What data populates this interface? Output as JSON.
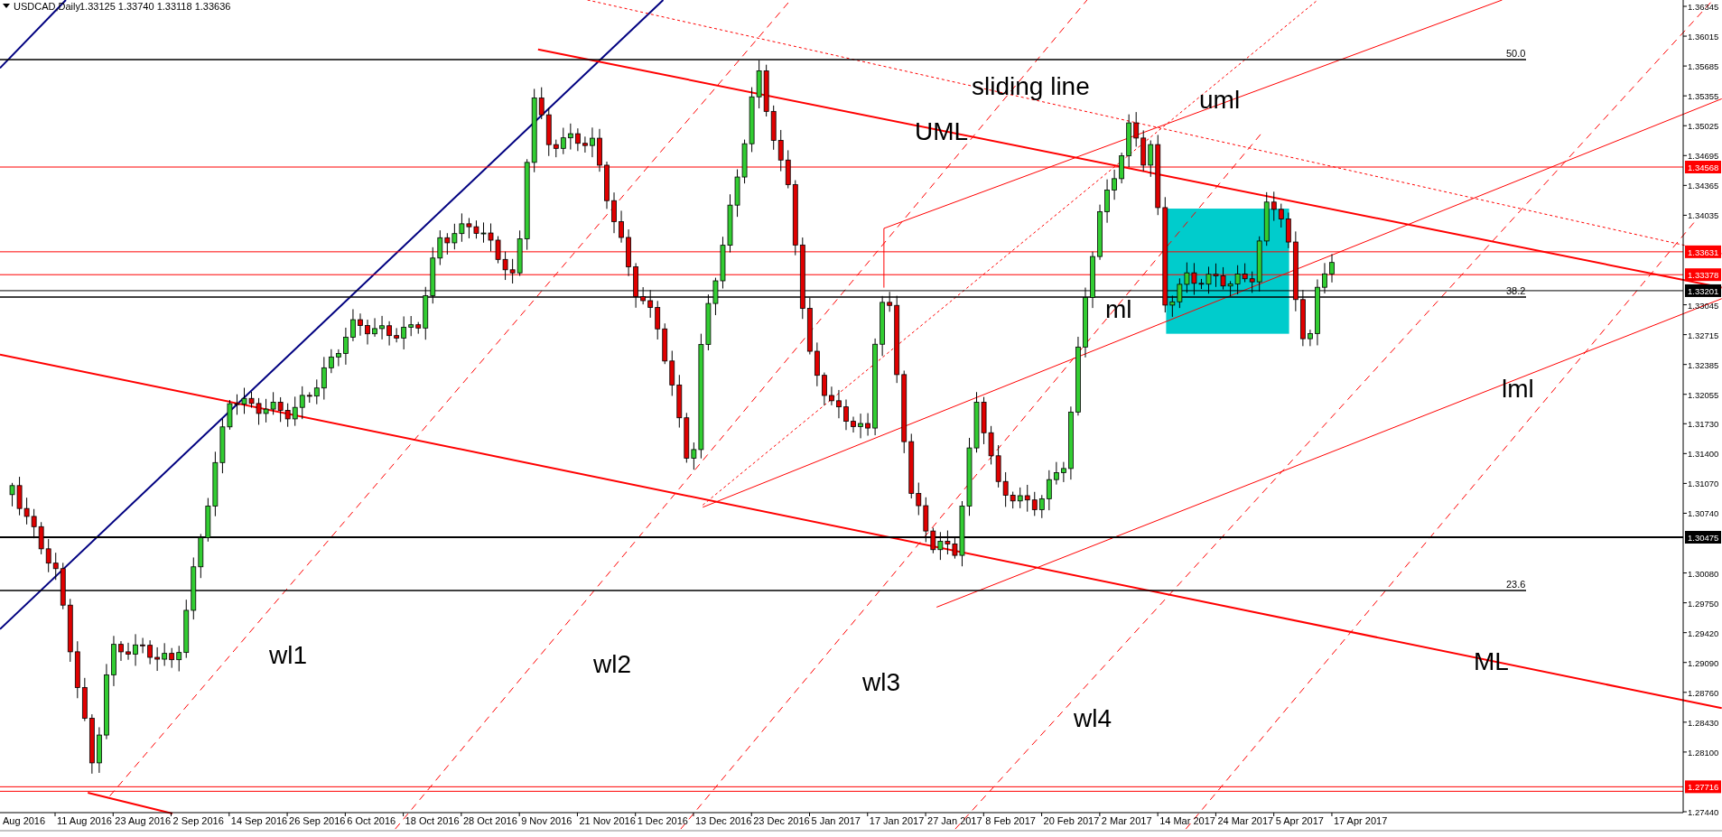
{
  "chart": {
    "symbol": "USDCAD,Daily",
    "ohlc": [
      "1.33125",
      "1.33740",
      "1.33118",
      "1.33636"
    ]
  },
  "price_axis": [
    "1.36345",
    "1.36015",
    "1.35685",
    "1.35355",
    "1.35025",
    "1.34695",
    "1.34365",
    "1.34035",
    "1.33045",
    "1.32715",
    "1.32385",
    "1.32055",
    "1.31730",
    "1.31400",
    "1.31070",
    "1.30740",
    "1.30080",
    "1.29750",
    "1.29420",
    "1.29090",
    "1.28760",
    "1.28430",
    "1.28100",
    "1.27440"
  ],
  "price_markers": [
    {
      "text": "1.34568",
      "color": "#ff0000"
    },
    {
      "text": "1.33631",
      "color": "#ff0000"
    },
    {
      "text": "1.33378",
      "color": "#ff0000"
    },
    {
      "text": "1.33201",
      "color": "#000000"
    },
    {
      "text": "1.30475",
      "color": "#000000"
    },
    {
      "text": "1.27716",
      "color": "#ff0000"
    }
  ],
  "fib_levels": [
    "50.0",
    "38.2",
    "23.6"
  ],
  "annotations": [
    "sliding line",
    "uml",
    "UML",
    "ml",
    "lml",
    "wl1",
    "wl2",
    "ML",
    "wl3",
    "wl4"
  ],
  "time_axis": [
    "Aug 2016",
    "11 Aug 2016",
    "23 Aug 2016",
    "2 Sep 2016",
    "14 Sep 2016",
    "26 Sep 2016",
    "6 Oct 2016",
    "18 Oct 2016",
    "28 Oct 2016",
    "9 Nov 2016",
    "21 Nov 2016",
    "1 Dec 2016",
    "13 Dec 2016",
    "23 Dec 2016",
    "5 Jan 2017",
    "17 Jan 2017",
    "27 Jan 2017",
    "8 Feb 2017",
    "20 Feb 2017",
    "2 Mar 2017",
    "14 Mar 2017",
    "24 Mar 2017",
    "5 Apr 2017",
    "17 Apr 2017"
  ]
}
